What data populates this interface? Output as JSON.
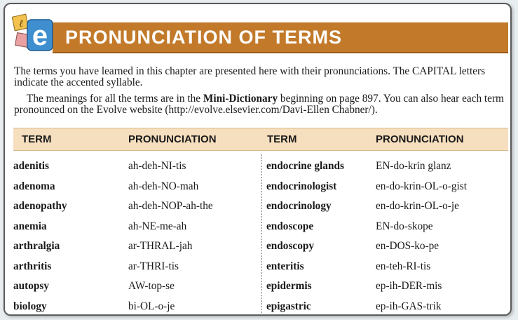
{
  "header": {
    "title": "PRONUNCIATION OF TERMS",
    "logo_letter": "e"
  },
  "intro": {
    "p1": "The terms you have learned in this chapter are presented here with their pronunciations. The CAPITAL letters indicate the accented syllable.",
    "p2_before": "The meanings for all the terms are in the ",
    "p2_bold": "Mini-Dictionary",
    "p2_after": " beginning on page 897. You can also hear each term pronounced on the Evolve website (http://evolve.elsevier.com/Davi-Ellen Chabner/)."
  },
  "table": {
    "headers": [
      "TERM",
      "PRONUNCIATION",
      "TERM",
      "PRONUNCIATION"
    ],
    "left": [
      {
        "term": "adenitis",
        "pron": "ah-deh-NI-tis"
      },
      {
        "term": "adenoma",
        "pron": "ah-deh-NO-mah"
      },
      {
        "term": "adenopathy",
        "pron": "ah-deh-NOP-ah-the"
      },
      {
        "term": "anemia",
        "pron": "ah-NE-me-ah"
      },
      {
        "term": "arthralgia",
        "pron": "ar-THRAL-jah"
      },
      {
        "term": "arthritis",
        "pron": "ar-THRI-tis"
      },
      {
        "term": "autopsy",
        "pron": "AW-top-se"
      },
      {
        "term": "biology",
        "pron": "bi-OL-o-je"
      }
    ],
    "right": [
      {
        "term": "endocrine glands",
        "pron": "EN-do-krin  glanz"
      },
      {
        "term": "endocrinologist",
        "pron": "en-do-krin-OL-o-gist"
      },
      {
        "term": "endocrinology",
        "pron": "en-do-krin-OL-o-je"
      },
      {
        "term": "endoscope",
        "pron": "EN-do-skope"
      },
      {
        "term": "endoscopy",
        "pron": "en-DOS-ko-pe"
      },
      {
        "term": "enteritis",
        "pron": "en-teh-RI-tis"
      },
      {
        "term": "epidermis",
        "pron": "ep-ih-DER-mis"
      },
      {
        "term": "epigastric",
        "pron": "ep-ih-GAS-trik"
      }
    ]
  },
  "colors": {
    "banner": "#c27a2a",
    "table_header": "#f6dfbf",
    "logo_e": "#3a9a3a"
  }
}
